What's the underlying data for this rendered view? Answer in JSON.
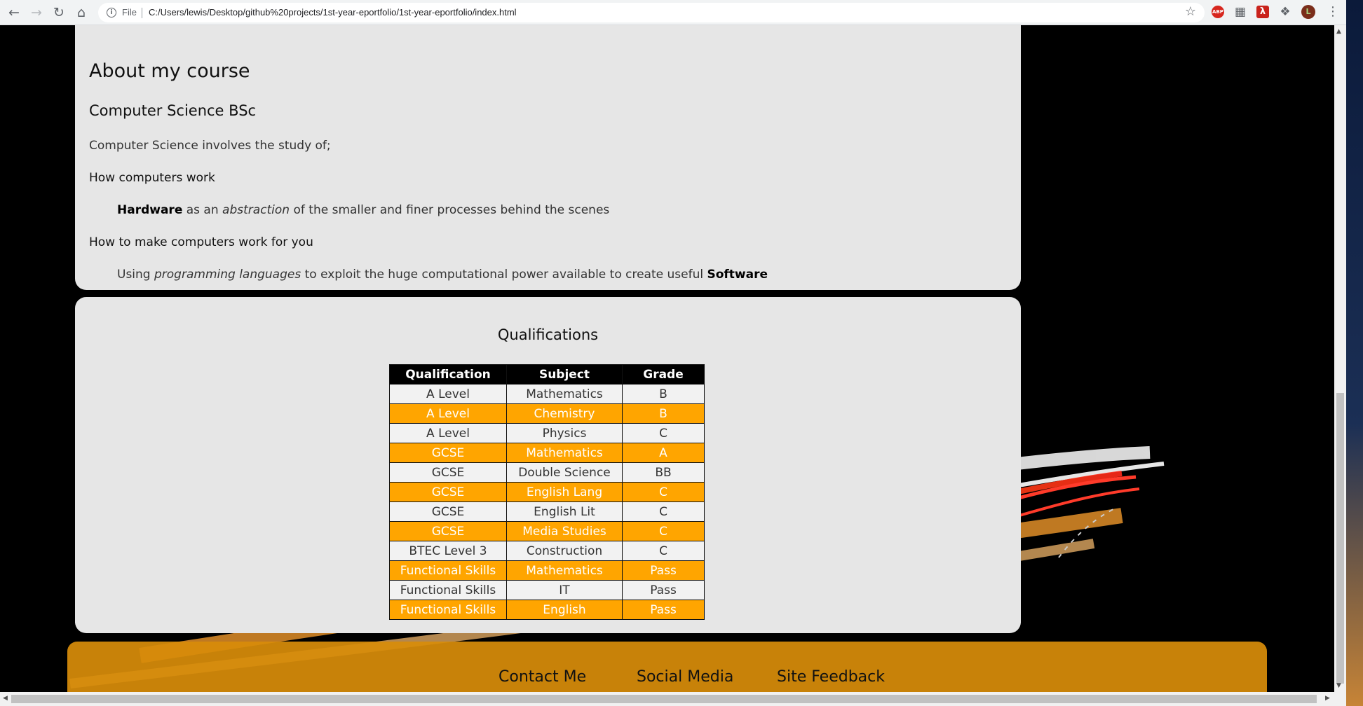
{
  "browser": {
    "url_scheme": "File",
    "url": "C:/Users/lewis/Desktop/github%20projects/1st-year-eportfolio/1st-year-eportfolio/index.html",
    "extensions": [
      "abp-icon",
      "grid-icon",
      "pdf-icon",
      "puzzle-icon"
    ],
    "abp_text": "ABP",
    "avatar_initial": "L"
  },
  "course": {
    "title": "About my course",
    "degree": "Computer Science BSc",
    "intro": "Computer Science involves the study of;",
    "topic1": {
      "heading": "How computers work",
      "strong": "Hardware",
      "text_a": " as an ",
      "italic": "abstraction",
      "text_b": " of the smaller and finer processes behind the scenes"
    },
    "topic2": {
      "heading": "How to make computers work for you",
      "text_a": "Using ",
      "italic": "programming languages",
      "text_b": " to exploit the huge computational power available to create useful ",
      "strong": "Software"
    }
  },
  "qualifications": {
    "title": "Qualifications",
    "headers": [
      "Qualification",
      "Subject",
      "Grade"
    ],
    "rows": [
      [
        "A Level",
        "Mathematics",
        "B"
      ],
      [
        "A Level",
        "Chemistry",
        "B"
      ],
      [
        "A Level",
        "Physics",
        "C"
      ],
      [
        "GCSE",
        "Mathematics",
        "A"
      ],
      [
        "GCSE",
        "Double Science",
        "BB"
      ],
      [
        "GCSE",
        "English Lang",
        "C"
      ],
      [
        "GCSE",
        "English Lit",
        "C"
      ],
      [
        "GCSE",
        "Media Studies",
        "C"
      ],
      [
        "BTEC Level 3",
        "Construction",
        "C"
      ],
      [
        "Functional Skills",
        "Mathematics",
        "Pass"
      ],
      [
        "Functional Skills",
        "IT",
        "Pass"
      ],
      [
        "Functional Skills",
        "English",
        "Pass"
      ]
    ]
  },
  "footer": {
    "links": [
      "Contact Me",
      "Social Media",
      "Site Feedback"
    ]
  },
  "colors": {
    "accent": "#ffa500",
    "panel": "#e6e6e6",
    "footer": "#d78c0a"
  }
}
